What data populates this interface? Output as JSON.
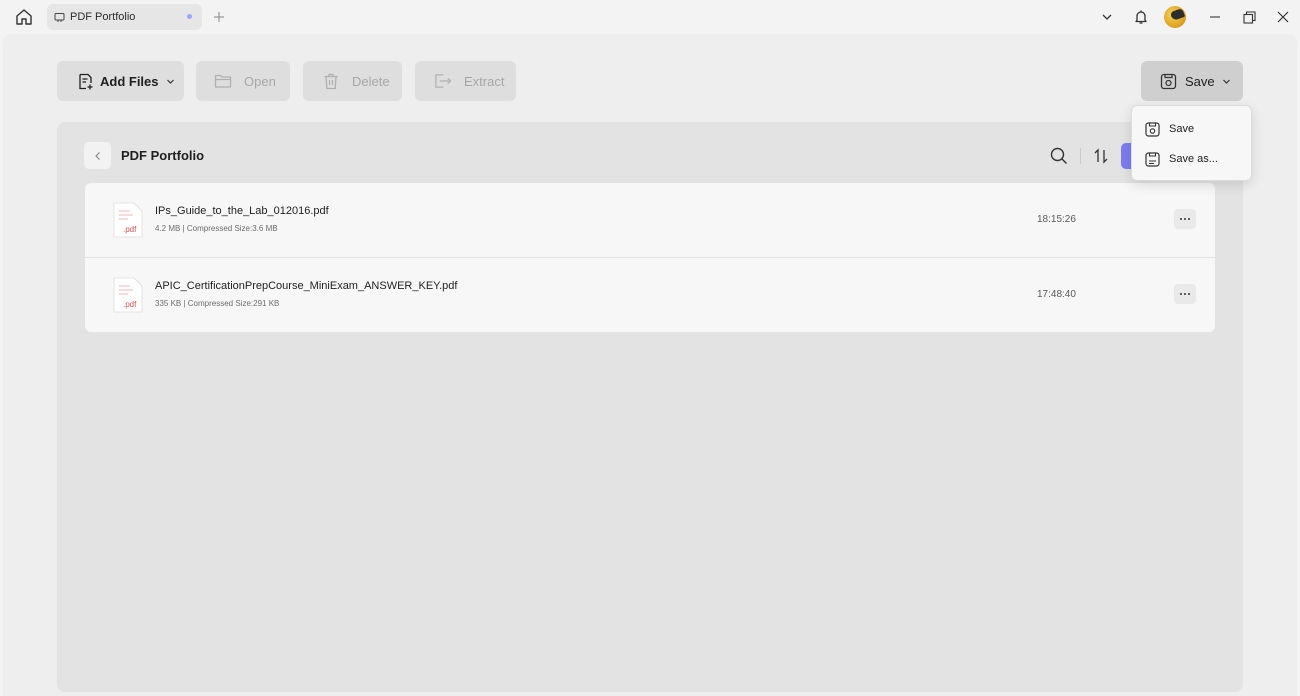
{
  "titlebar": {
    "tab_label": "PDF Portfolio",
    "icons": [
      "home-icon",
      "document-icon",
      "plus-icon",
      "chevron-down-icon",
      "bell-icon",
      "avatar",
      "minimize-icon",
      "restore-icon",
      "close-icon"
    ]
  },
  "toolbar": {
    "add_files_label": "Add Files",
    "open_label": "Open",
    "delete_label": "Delete",
    "extract_label": "Extract",
    "save_label": "Save"
  },
  "panel": {
    "title": "PDF Portfolio"
  },
  "files": [
    {
      "name": "IPs_Guide_to_the_Lab_012016.pdf",
      "meta": "4.2 MB | Compressed Size:3.6 MB",
      "time": "18:15:26",
      "ext": ".pdf"
    },
    {
      "name": "APIC_CertificationPrepCourse_MiniExam_ANSWER_KEY.pdf",
      "meta": "335 KB | Compressed Size:291 KB",
      "time": "17:48:40",
      "ext": ".pdf"
    }
  ],
  "save_menu": {
    "items": [
      {
        "label": "Save"
      },
      {
        "label": "Save as..."
      }
    ]
  },
  "colors": {
    "accent": "#7c7cf0",
    "pdf_red": "#d9534f"
  }
}
